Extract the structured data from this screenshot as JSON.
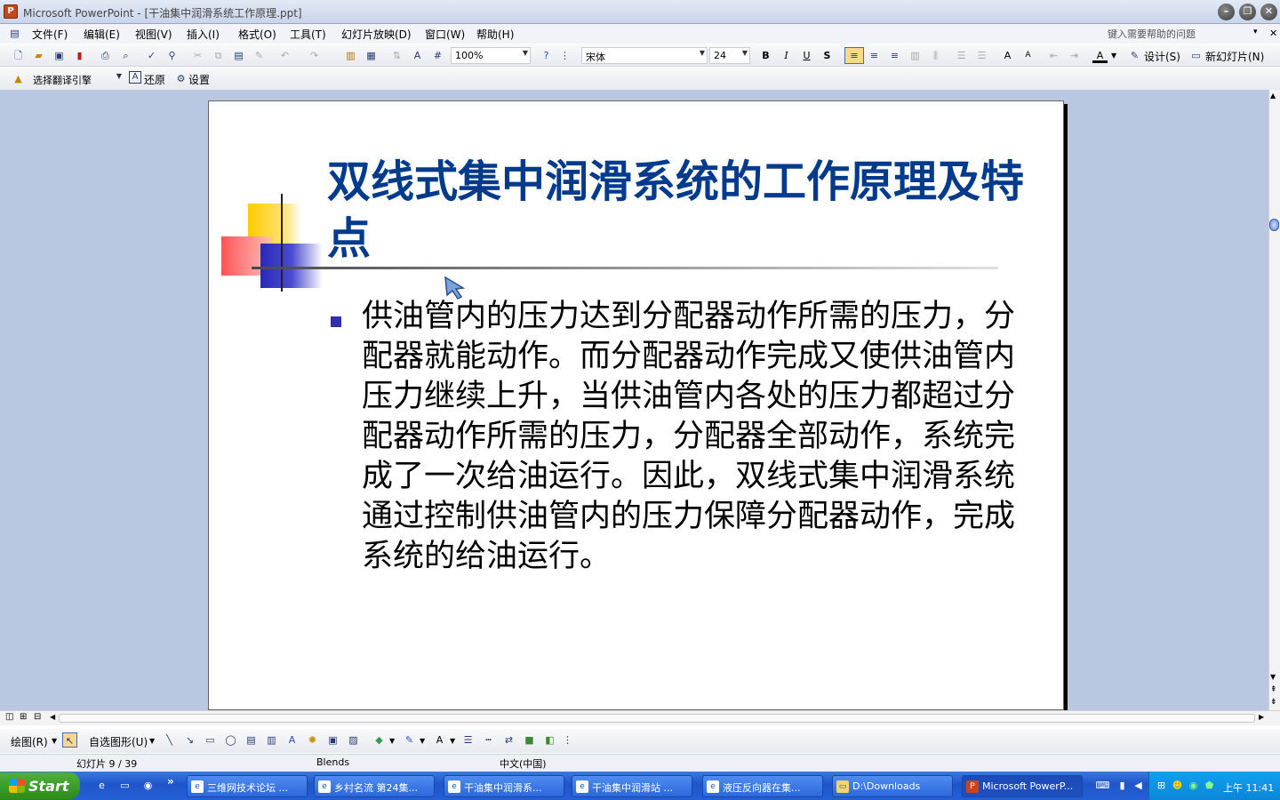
{
  "window": {
    "app_icon": "P",
    "title": "Microsoft PowerPoint - [干油集中润滑系统工作原理.ppt]",
    "controls": [
      "minimize-icon",
      "restore-icon",
      "close-icon"
    ]
  },
  "menu": {
    "items": [
      "文件(F)",
      "编辑(E)",
      "视图(V)",
      "插入(I)",
      "格式(O)",
      "工具(T)",
      "幻灯片放映(D)",
      "窗口(W)",
      "帮助(H)"
    ],
    "help_placeholder": "键入需要帮助的问题"
  },
  "toolbar": {
    "zoom": "100%",
    "font_name": "宋体",
    "font_size": "24",
    "bold": "B",
    "italic": "I",
    "underline": "U",
    "shadow": "S",
    "design_label": "设计(S)",
    "new_slide_label": "新幻灯片(N)"
  },
  "translate_bar": {
    "engine_select": "选择翻译引擎",
    "restore_label": "还原",
    "settings_label": "设置"
  },
  "slide": {
    "title": "双线式集中润滑系统的工作原理及特点",
    "body": "供油管内的压力达到分配器动作所需的压力，分配器就能动作。而分配器动作完成又使供油管内压力继续上升，当供油管内各处的压力都超过分配器动作所需的压力，分配器全部动作，系统完成了一次给油运行。因此，双线式集中润滑系统通过控制供油管内的压力保障分配器动作，完成系统的给油运行。"
  },
  "drawing_toolbar": {
    "draw_label": "绘图(R)",
    "autoshapes_label": "自选图形(U)"
  },
  "status": {
    "slide_position": "幻灯片 9 / 39",
    "template": "Blends",
    "language": "中文(中国)"
  },
  "taskbar": {
    "start_label": "Start",
    "tasks": [
      "三维网技术论坛 ...",
      "乡村名流 第24集...",
      "干油集中润滑系...",
      "干油集中润滑站 ...",
      "液压反向器在集...",
      "D:\\Downloads",
      "Microsoft PowerP..."
    ],
    "clock": "上午 11:41"
  }
}
